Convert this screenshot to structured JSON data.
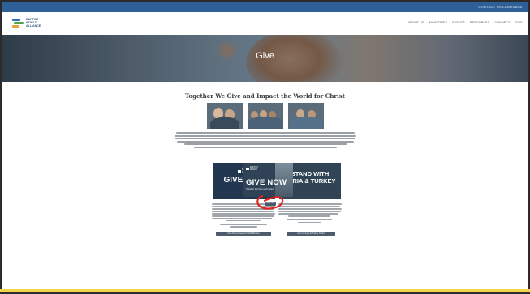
{
  "utility_bar": {
    "links": "CONTACT US   LANGUAGE"
  },
  "header": {
    "logo_text": "BAPTIST WORLD ALLIANCE",
    "nav": [
      "ABOUT US",
      "MINISTRIES",
      "EVENTS",
      "RESOURCES",
      "CONNECT",
      "GIVE"
    ]
  },
  "hero": {
    "title": "Give"
  },
  "main": {
    "heading": "Together We Give and Impact the World for Christ",
    "cards": [
      {
        "title": "GIVE NOW",
        "button": "Give Now to support BWA Ministry"
      },
      {
        "title_line1": "STAND WITH",
        "title_line2": "SYRIA & TURKEY",
        "button": "Give to Syria & Turkey Relief"
      }
    ],
    "card3": {
      "title": "GIVE NOW",
      "subtitle": "Together We Give and Impact"
    },
    "learn_more": "Learn More"
  },
  "colors": {
    "utility_bar": "#2e5f96",
    "card_dark": "#2f4256",
    "button": "#4b5b6b",
    "annotation": "#e0231f",
    "bottom_strip": "#f2d54a"
  }
}
